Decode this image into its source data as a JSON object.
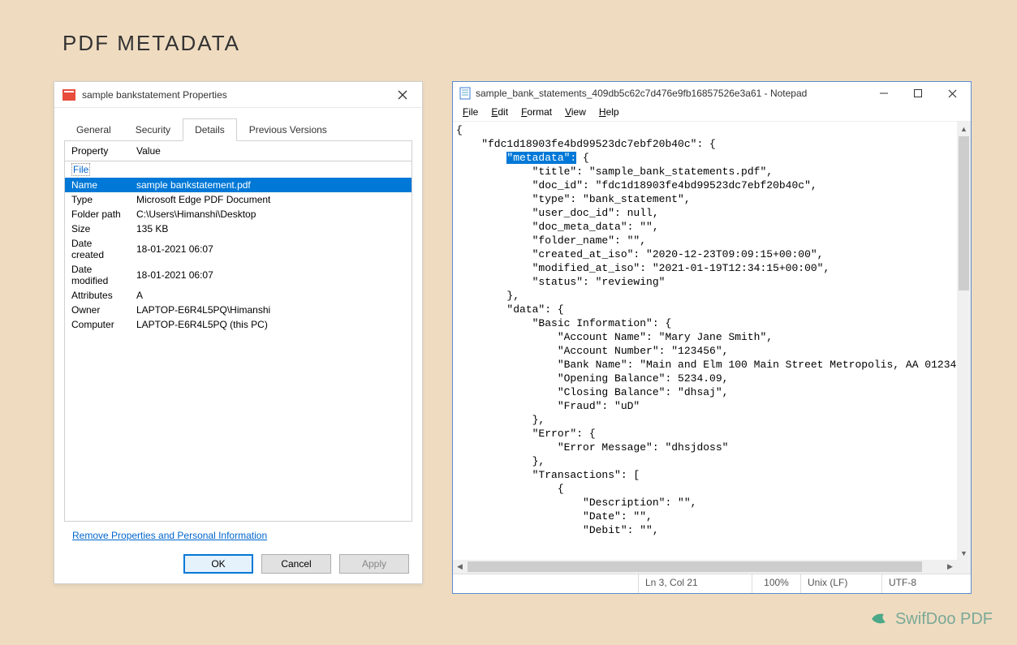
{
  "page": {
    "title": "PDF METADATA"
  },
  "properties": {
    "window_title": "sample bankstatement Properties",
    "tabs": [
      "General",
      "Security",
      "Details",
      "Previous Versions"
    ],
    "active_tab_index": 2,
    "columns": [
      "Property",
      "Value"
    ],
    "group_label": "File",
    "rows": [
      {
        "property": "Name",
        "value": "sample bankstatement.pdf",
        "selected": true
      },
      {
        "property": "Type",
        "value": "Microsoft Edge PDF Document"
      },
      {
        "property": "Folder path",
        "value": "C:\\Users\\Himanshi\\Desktop"
      },
      {
        "property": "Size",
        "value": "135 KB"
      },
      {
        "property": "Date created",
        "value": "18-01-2021 06:07"
      },
      {
        "property": "Date modified",
        "value": "18-01-2021 06:07"
      },
      {
        "property": "Attributes",
        "value": "A"
      },
      {
        "property": "Owner",
        "value": "LAPTOP-E6R4L5PQ\\Himanshi"
      },
      {
        "property": "Computer",
        "value": "LAPTOP-E6R4L5PQ (this PC)"
      }
    ],
    "remove_link": "Remove Properties and Personal Information",
    "buttons": {
      "ok": "OK",
      "cancel": "Cancel",
      "apply": "Apply"
    }
  },
  "notepad": {
    "window_title": "sample_bank_statements_409db5c62c7d476e9fb16857526e3a61 - Notepad",
    "menu": [
      "File",
      "Edit",
      "Format",
      "View",
      "Help"
    ],
    "highlight_text": "\"metadata\":",
    "json_lines": [
      "{",
      "    \"fdc1d18903fe4bd99523dc7ebf20b40c\": {",
      "        __HL__ {",
      "            \"title\": \"sample_bank_statements.pdf\",",
      "            \"doc_id\": \"fdc1d18903fe4bd99523dc7ebf20b40c\",",
      "            \"type\": \"bank_statement\",",
      "            \"user_doc_id\": null,",
      "            \"doc_meta_data\": \"\",",
      "            \"folder_name\": \"\",",
      "            \"created_at_iso\": \"2020-12-23T09:09:15+00:00\",",
      "            \"modified_at_iso\": \"2021-01-19T12:34:15+00:00\",",
      "            \"status\": \"reviewing\"",
      "        },",
      "        \"data\": {",
      "            \"Basic Information\": {",
      "                \"Account Name\": \"Mary Jane Smith\",",
      "                \"Account Number\": \"123456\",",
      "                \"Bank Name\": \"Main and Elm 100 Main Street Metropolis, AA 01234\",",
      "                \"Opening Balance\": 5234.09,",
      "                \"Closing Balance\": \"dhsaj\",",
      "                \"Fraud\": \"uD\"",
      "            },",
      "            \"Error\": {",
      "                \"Error Message\": \"dhsjdoss\"",
      "            },",
      "            \"Transactions\": [",
      "                {",
      "                    \"Description\": \"\",",
      "                    \"Date\": \"\",",
      "                    \"Debit\": \"\","
    ],
    "status": {
      "pos": "Ln 3, Col 21",
      "zoom": "100%",
      "line_ending": "Unix (LF)",
      "encoding": "UTF-8"
    }
  },
  "logo": {
    "text": "SwifDoo PDF"
  }
}
